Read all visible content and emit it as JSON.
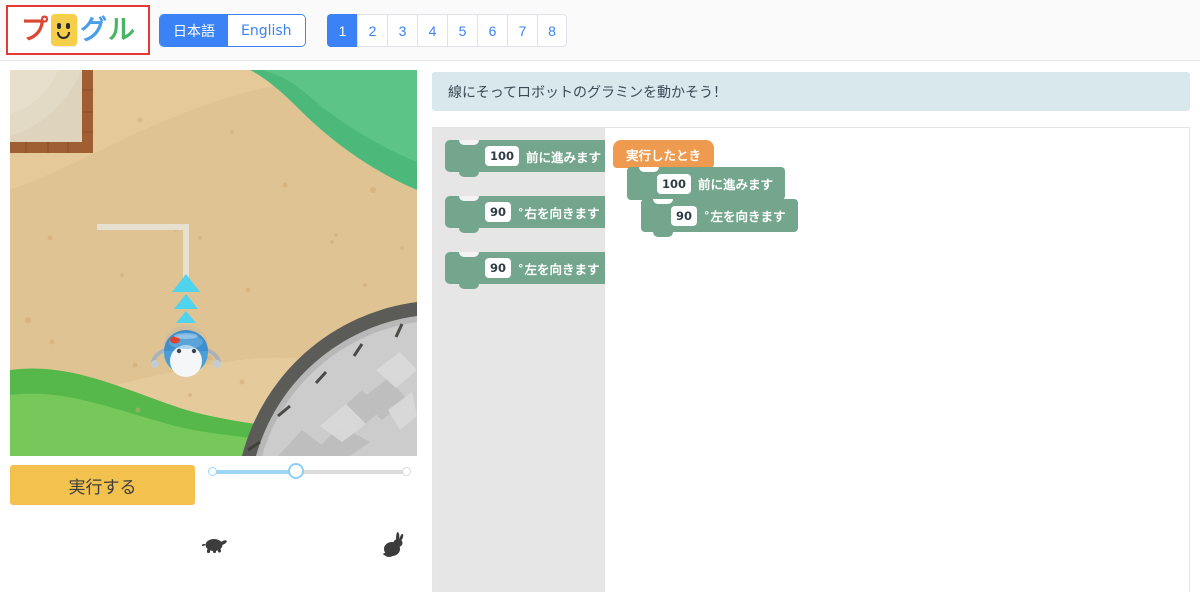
{
  "header": {
    "logo": {
      "name": "プログル",
      "chars": [
        "プ",
        "グ",
        "ル"
      ],
      "colors": {
        "pu": "#dc4634",
        "card": "#f5ce4a",
        "gu": "#4a9fe8",
        "ru": "#48b563"
      },
      "selected_outline_color": "#e53935"
    },
    "language_toggle": {
      "options": [
        "日本語",
        "English"
      ],
      "selected": "日本語"
    },
    "pagination": {
      "pages": [
        "1",
        "2",
        "3",
        "4",
        "5",
        "6",
        "7",
        "8"
      ],
      "active": "1",
      "accent_color": "#3b82f6"
    }
  },
  "left_panel": {
    "run_button_label": "実行する",
    "run_button_color": "#f2c14e",
    "speed_slider": {
      "value_percent": 45,
      "slow_icon": "turtle-icon",
      "fast_icon": "rabbit-icon",
      "fill_color": "#9ed6f7"
    },
    "stage": {
      "ground_color": "#e5c999",
      "grass_color": "#5cc46f",
      "path_color": "#e5e0d0",
      "road_color": "#c9c9c9",
      "robot_name": "グラミン",
      "arrow_color": "#4fd3ef",
      "arrow_count": 3
    }
  },
  "instruction": {
    "text": "線にそってロボットのグラミンを動かそう！",
    "background": "#d8e8ec"
  },
  "editor": {
    "palette": {
      "background": "#e6e6e6",
      "blocks": [
        {
          "value": "100",
          "degree": "",
          "label": "前に進みます",
          "color": "#73a68d"
        },
        {
          "value": "90",
          "degree": "°",
          "label": "右を向きます",
          "color": "#73a68d"
        },
        {
          "value": "90",
          "degree": "°",
          "label": "左を向きます",
          "color": "#73a68d"
        }
      ]
    },
    "workspace": {
      "hat_label": "実行したとき",
      "hat_color": "#ee9b50",
      "blocks": [
        {
          "value": "100",
          "degree": "",
          "label": "前に進みます",
          "color": "#73a68d"
        },
        {
          "value": "90",
          "degree": "°",
          "label": "左を向きます",
          "color": "#73a68d"
        }
      ]
    }
  }
}
